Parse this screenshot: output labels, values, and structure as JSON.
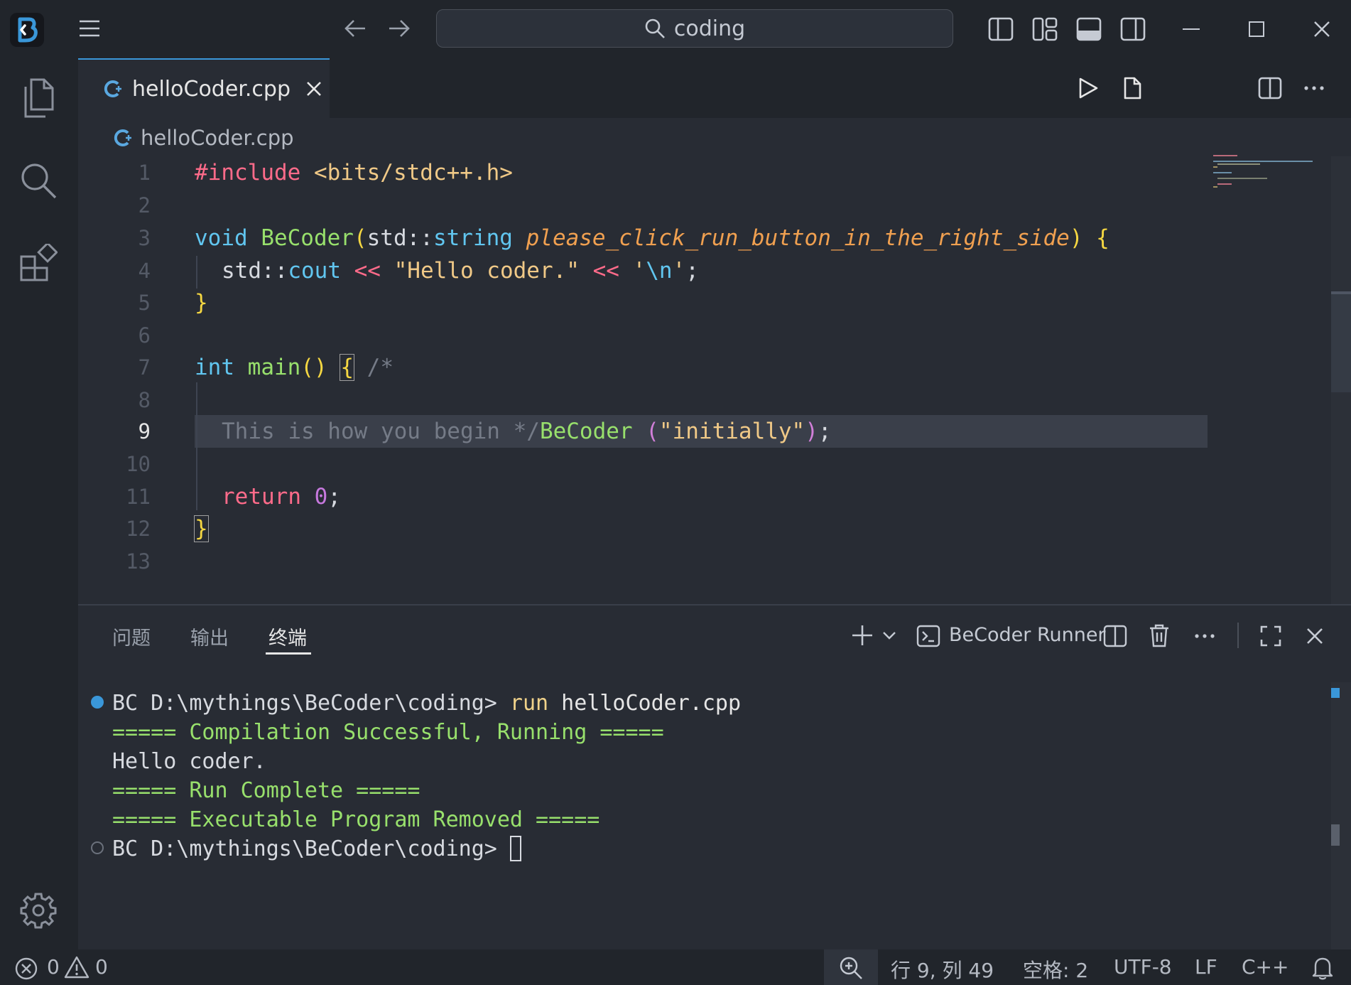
{
  "search": {
    "query": "coding"
  },
  "tab": {
    "filename": "helloCoder.cpp"
  },
  "breadcrumb": {
    "filename": "helloCoder.cpp"
  },
  "editor": {
    "line_numbers": [
      "1",
      "2",
      "3",
      "4",
      "5",
      "6",
      "7",
      "8",
      "9",
      "10",
      "11",
      "12",
      "13"
    ],
    "current_line": "9",
    "code": {
      "l1_directive": "#include",
      "l1_header": " <bits/stdc++.h>",
      "l3_void": "void",
      "l3_fn": " BeCoder",
      "l3_open": "(",
      "l3_ns": "std::",
      "l3_type": "string",
      "l3_param": " please_click_run_button_in_the_right_side",
      "l3_close": ")",
      "l3_brace": " {",
      "l4_ns": "std::",
      "l4_cout": "cout",
      "l4_op1": " << ",
      "l4_str": "\"Hello coder.\"",
      "l4_op2": " << ",
      "l4_q1": "'",
      "l4_esc": "\\n",
      "l4_q2": "'",
      "l4_semi": ";",
      "l5_brace": "}",
      "l7_int": "int",
      "l7_main": " main",
      "l7_parens": "()",
      "l7_brace": "{",
      "l7_comment": " /*",
      "l9_comment": "This is how you begin */",
      "l9_fn": "BeCoder",
      "l9_open": " (",
      "l9_str": "\"initially\"",
      "l9_close": ")",
      "l9_semi": ";",
      "l11_return": "return",
      "l11_num": " 0",
      "l11_semi": ";",
      "l12_brace": "}"
    }
  },
  "panel": {
    "tabs": [
      "问题",
      "输出",
      "终端"
    ],
    "active_tab": "终端",
    "terminal_name": "BeCoder Runner",
    "terminal": {
      "line1_prompt": "BC D:\\mythings\\BeCoder\\coding> ",
      "line1_cmd": "run",
      "line1_arg": " helloCoder.cpp",
      "line2": "===== Compilation Successful, Running =====",
      "line3": "Hello coder.",
      "line4": "===== Run Complete =====",
      "line5": "===== Executable Program Removed =====",
      "line6_prompt": "BC D:\\mythings\\BeCoder\\coding> "
    }
  },
  "statusbar": {
    "errors": "0",
    "warnings": "0",
    "position": "行 9, 列 49",
    "indent": "空格: 2",
    "encoding": "UTF-8",
    "eol": "LF",
    "language": "C++"
  },
  "colors": {
    "accent": "#3a97d9",
    "background": "#282c34",
    "chrome": "#21252b"
  }
}
